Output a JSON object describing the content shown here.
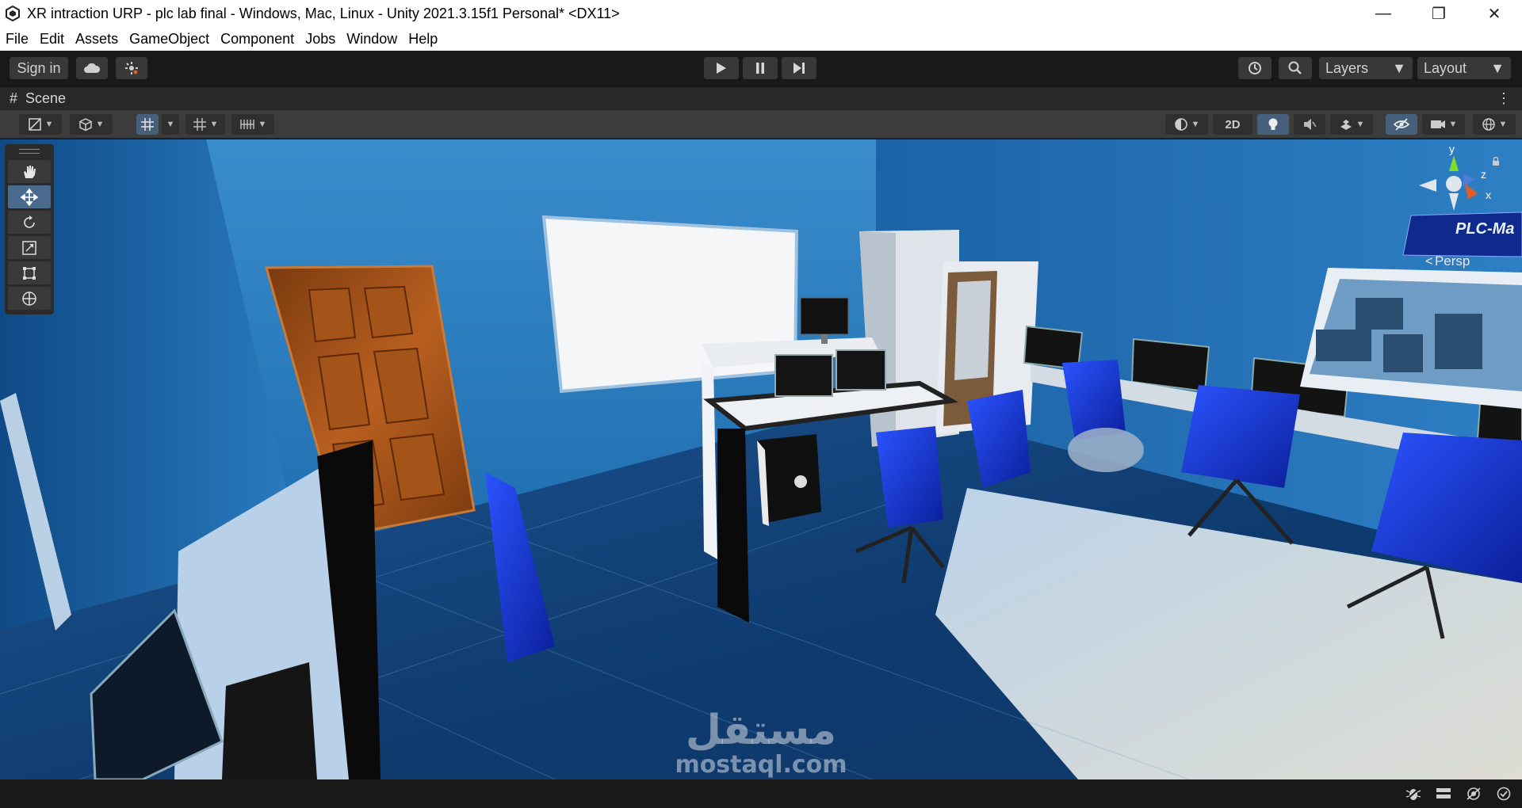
{
  "window": {
    "title": "XR intraction URP - plc lab final - Windows, Mac, Linux - Unity 2021.3.15f1 Personal* <DX11>",
    "minimize_glyph": "—",
    "maximize_glyph": "❐",
    "close_glyph": "✕"
  },
  "menu": [
    "File",
    "Edit",
    "Assets",
    "GameObject",
    "Component",
    "Jobs",
    "Window",
    "Help"
  ],
  "toolbar": {
    "sign_in": "Sign in",
    "layers": "Layers",
    "layout": "Layout"
  },
  "scene_tab": {
    "label": "Scene"
  },
  "scene_toolbar": {
    "mode_2d": "2D"
  },
  "gizmo": {
    "y": "y",
    "z": "z",
    "x": "x",
    "persp": "Persp"
  },
  "scene_text": {
    "panel_label": "PLC-Ma"
  },
  "watermark": {
    "arabic": "مستقل",
    "latin": "mostaql.com"
  },
  "colors": {
    "wall_blue": "#1f6fb0",
    "floor_blue": "#123f73",
    "chair_blue": "#1230c8",
    "door_brown": "#9a4a14",
    "accent_toggle": "#46607c"
  }
}
